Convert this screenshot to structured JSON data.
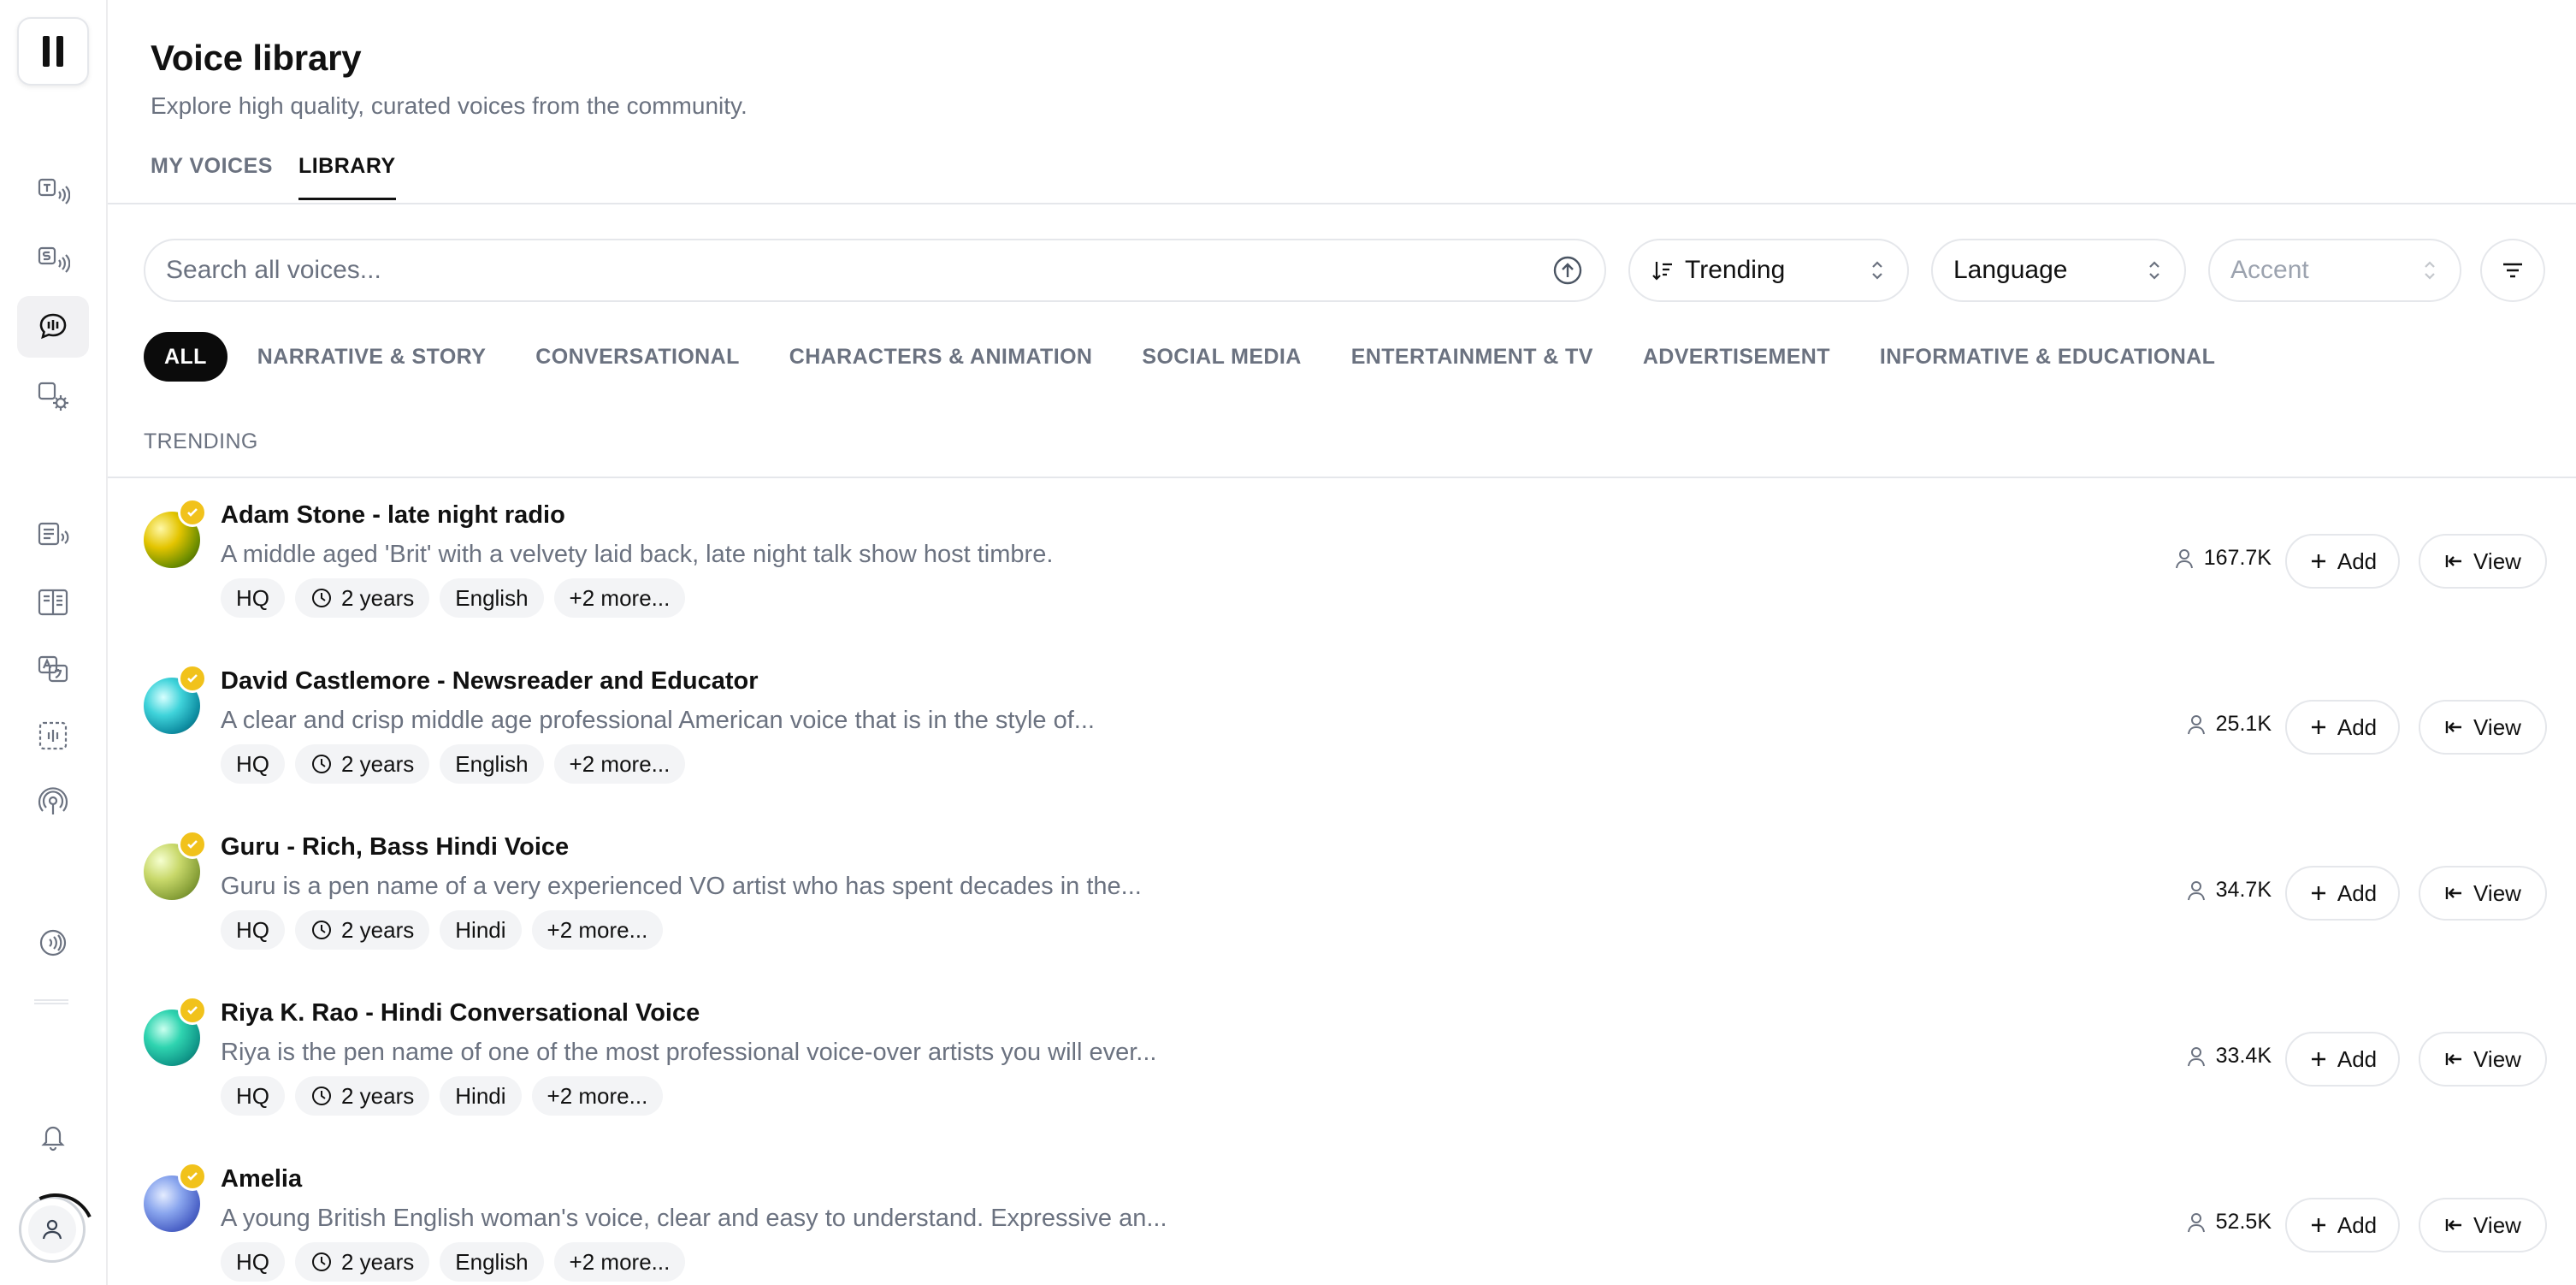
{
  "header": {
    "title": "Voice library",
    "subtitle": "Explore high quality, curated voices from the community."
  },
  "tabs": [
    {
      "label": "MY VOICES",
      "active": false
    },
    {
      "label": "LIBRARY",
      "active": true
    }
  ],
  "search": {
    "placeholder": "Search all voices..."
  },
  "filters": {
    "sort": "Trending",
    "language": "Language",
    "accent": "Accent"
  },
  "categories": [
    "ALL",
    "NARRATIVE & STORY",
    "CONVERSATIONAL",
    "CHARACTERS & ANIMATION",
    "SOCIAL MEDIA",
    "ENTERTAINMENT & TV",
    "ADVERTISEMENT",
    "INFORMATIVE & EDUCATIONAL"
  ],
  "section_label": "TRENDING",
  "voices": [
    {
      "name": "Adam Stone - late night radio",
      "description": "A middle aged 'Brit' with a velvety laid back, late night talk show host timbre.",
      "tags": {
        "quality": "HQ",
        "age": "2 years",
        "language": "English",
        "more": "+2 more..."
      },
      "users": "167.7K"
    },
    {
      "name": "David Castlemore - Newsreader and Educator",
      "description": "A clear and crisp middle age professional American voice that is in the style of...",
      "tags": {
        "quality": "HQ",
        "age": "2 years",
        "language": "English",
        "more": "+2 more..."
      },
      "users": "25.1K"
    },
    {
      "name": "Guru - Rich, Bass Hindi Voice",
      "description": "Guru is a pen name of a very experienced VO artist who has spent decades in the...",
      "tags": {
        "quality": "HQ",
        "age": "2 years",
        "language": "Hindi",
        "more": "+2 more..."
      },
      "users": "34.7K"
    },
    {
      "name": "Riya K. Rao - Hindi Conversational Voice",
      "description": "Riya is the pen name of one of the most professional voice-over artists you will ever...",
      "tags": {
        "quality": "HQ",
        "age": "2 years",
        "language": "Hindi",
        "more": "+2 more..."
      },
      "users": "33.4K"
    },
    {
      "name": "Amelia",
      "description": "A young British English woman's voice, clear and easy to understand. Expressive an...",
      "tags": {
        "quality": "HQ",
        "age": "2 years",
        "language": "English",
        "more": "+2 more..."
      },
      "users": "52.5K"
    }
  ],
  "actions": {
    "add_label": "Add",
    "view_label": "View"
  },
  "colors": {
    "accent": "#0b0b0b",
    "badge": "#f1c21b",
    "muted_text": "#6b7280",
    "border": "#e5e7eb"
  }
}
